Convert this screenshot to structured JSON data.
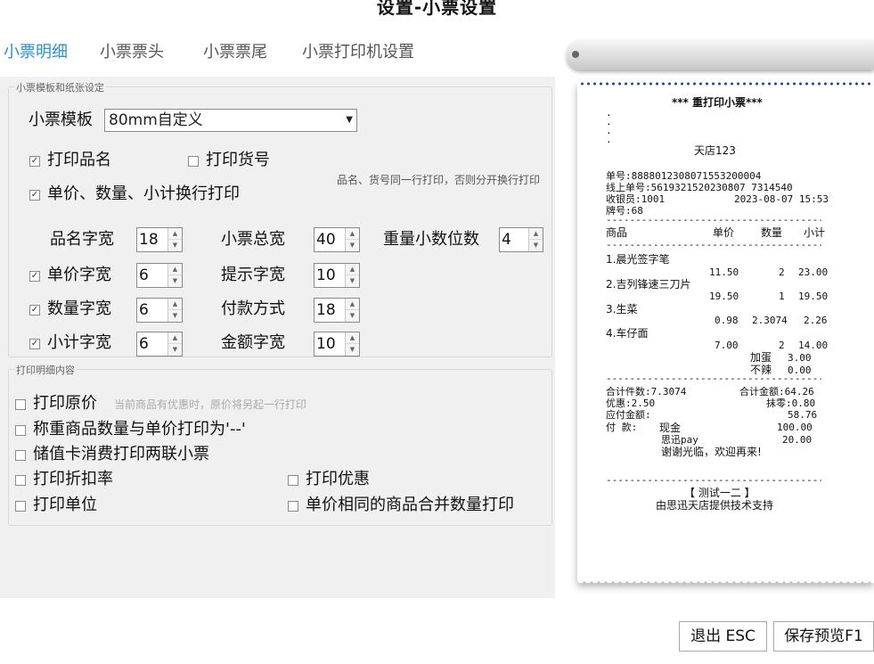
{
  "window": {
    "title": "设置-小票设置"
  },
  "tabs": [
    {
      "label": "小票明细",
      "active": true
    },
    {
      "label": "小票票头"
    },
    {
      "label": "小票票尾"
    },
    {
      "label": "小票打印机设置"
    }
  ],
  "template_group": {
    "legend": "小票模板和纸张设定",
    "template_label": "小票模板",
    "template_value": "80mm自定义",
    "print_name": {
      "label": "打印品名",
      "checked": true
    },
    "print_sku": {
      "label": "打印货号",
      "checked": false
    },
    "same_line_hint": "品名、货号同一行打印，否则分开换行打印",
    "wrap_price": {
      "label": "单价、数量、小计换行打印",
      "checked": true
    },
    "name_width": {
      "label": "品名字宽",
      "value": "18"
    },
    "total_width": {
      "label": "小票总宽",
      "value": "40"
    },
    "weight_decimals": {
      "label": "重量小数位数",
      "value": "4"
    },
    "price_width": {
      "label": "单价字宽",
      "value": "6",
      "checked": true
    },
    "hint_width": {
      "label": "提示字宽",
      "value": "10"
    },
    "qty_width": {
      "label": "数量字宽",
      "value": "6",
      "checked": true
    },
    "payment_width": {
      "label": "付款方式",
      "value": "18"
    },
    "subtotal_width": {
      "label": "小计字宽",
      "value": "6",
      "checked": true
    },
    "amount_width": {
      "label": "金额字宽",
      "value": "10"
    }
  },
  "detail_group": {
    "legend": "打印明细内容",
    "print_original_price": {
      "label": "打印原价",
      "hint": "当前商品有优惠时，原价将另起一行打印",
      "checked": false
    },
    "weighted_dash": {
      "label": "称重商品数量与单价打印为'--'",
      "checked": false
    },
    "stored_card_two": {
      "label": "储值卡消费打印两联小票",
      "checked": false
    },
    "print_discount_rate": {
      "label": "打印折扣率",
      "checked": false
    },
    "print_promotion": {
      "label": "打印优惠",
      "checked": false
    },
    "print_unit": {
      "label": "打印单位",
      "checked": false
    },
    "merge_same_price": {
      "label": "单价相同的商品合并数量打印",
      "checked": false
    }
  },
  "receipt": {
    "title": "*** 重打印小票***",
    "dot_lines": [
      "·",
      "·",
      "·",
      "·"
    ],
    "store": "天店123",
    "order_no": "单号:8888012308071553200004",
    "online_no": "线上单号:5619321520230807 7314540",
    "cashier": "收银员:1001",
    "datetime": "2023-08-07 15:53",
    "plate": "牌号:68",
    "separator": "--------------------------------------------",
    "head": {
      "name": "商品",
      "price": "单价",
      "qty": "数量",
      "subtotal": "小计"
    },
    "items": [
      {
        "name": "1.晨光签字笔",
        "price": "11.50",
        "qty": "2",
        "subtotal": "23.00"
      },
      {
        "name": "2.吉列锋速三刀片",
        "price": "19.50",
        "qty": "1",
        "subtotal": "19.50"
      },
      {
        "name": "3.生菜",
        "price": "0.98",
        "qty": "2.3074",
        "subtotal": "2.26"
      },
      {
        "name": "4.车仔面",
        "price": "7.00",
        "qty": "2",
        "subtotal": "14.00"
      }
    ],
    "extras": [
      {
        "name": "加蛋",
        "value": "3.00"
      },
      {
        "name": "不辣",
        "value": "0.00"
      }
    ],
    "total_count": "合计件数:7.3074",
    "total_amount": "合计金额:64.26",
    "discount": "优惠:2.50",
    "rounding": "抹零:0.80",
    "payable_label": "应付金额:",
    "payable": "58.76",
    "pay_label": "付  款:",
    "payments": [
      {
        "method": "现金",
        "amount": "100.00"
      },
      {
        "method": "思迅pay",
        "amount": "20.00"
      }
    ],
    "thanks": "谢谢光临，欢迎再来!",
    "footer_store": "【 测试一二 】",
    "footer_support": "由思迅天店提供技术支持"
  },
  "buttons": {
    "exit": "退出 ESC",
    "save_preview": "保存预览F1"
  }
}
